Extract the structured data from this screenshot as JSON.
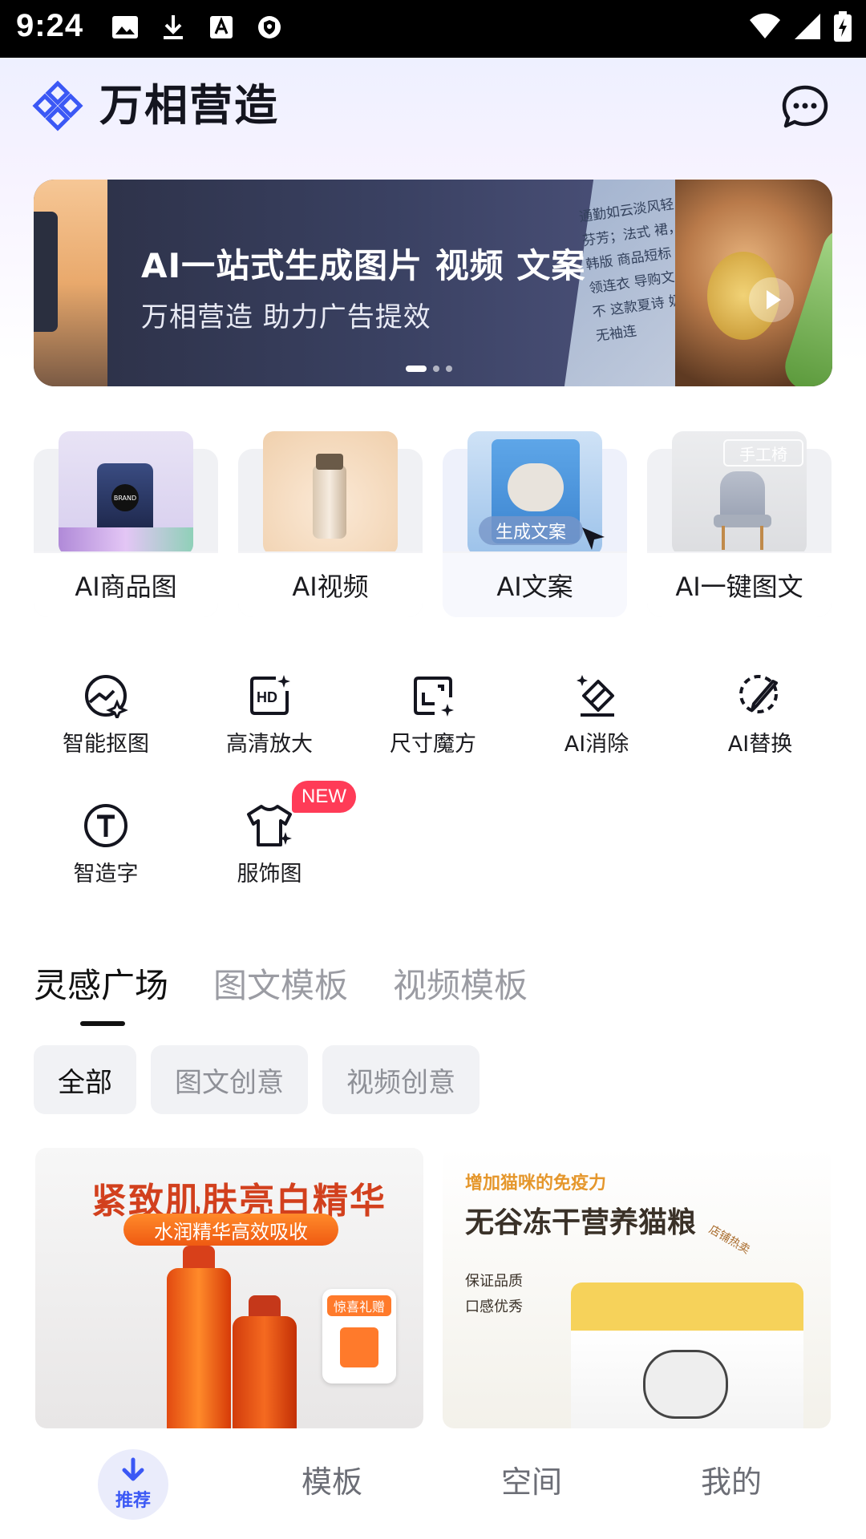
{
  "status_bar": {
    "time": "9:24"
  },
  "header": {
    "app_title": "万相营造"
  },
  "banner": {
    "title": "AI一站式生成图片 视频 文案",
    "subtitle": "万相营造 助力广告提效",
    "doc_text": "通勤如云淡风轻 奶糖芬芳；法式 裙，穿出韩版 商品短标 法式V领连衣 导购文 我试过不 这款夏诗 奶糖法式 无袖连"
  },
  "features": [
    {
      "label": "AI商品图"
    },
    {
      "label": "AI视频"
    },
    {
      "label": "AI文案",
      "overlay": "生成文案"
    },
    {
      "label": "AI一键图文",
      "overlay": "手工椅"
    }
  ],
  "tools": [
    {
      "label": "智能抠图",
      "icon": "smart-cutout-icon"
    },
    {
      "label": "高清放大",
      "icon": "hd-upscale-icon"
    },
    {
      "label": "尺寸魔方",
      "icon": "resize-icon"
    },
    {
      "label": "AI消除",
      "icon": "eraser-icon"
    },
    {
      "label": "AI替换",
      "icon": "brush-icon"
    },
    {
      "label": "智造字",
      "icon": "text-icon"
    },
    {
      "label": "服饰图",
      "icon": "tshirt-icon"
    }
  ],
  "new_badge": "NEW",
  "tabs": [
    {
      "label": "灵感广场",
      "active": true
    },
    {
      "label": "图文模板"
    },
    {
      "label": "视频模板"
    }
  ],
  "chips": [
    {
      "label": "全部",
      "active": true
    },
    {
      "label": "图文创意"
    },
    {
      "label": "视频创意"
    }
  ],
  "cards": {
    "card1": {
      "title": "紧致肌肤亮白精华",
      "pill": "水润精华高效吸收",
      "gift_tag": "惊喜礼赠"
    },
    "card2": {
      "small": "增加猫咪的免疫力",
      "title": "无谷冻干营养猫粮",
      "bullets": [
        "保证品质",
        "口感优秀"
      ],
      "stamp": "店铺热卖"
    }
  },
  "bottom_nav": {
    "home": "推荐",
    "templates": "模板",
    "space": "空间",
    "mine": "我的"
  },
  "colors": {
    "accent": "#3b58f5",
    "badge": "#ff3b57"
  }
}
